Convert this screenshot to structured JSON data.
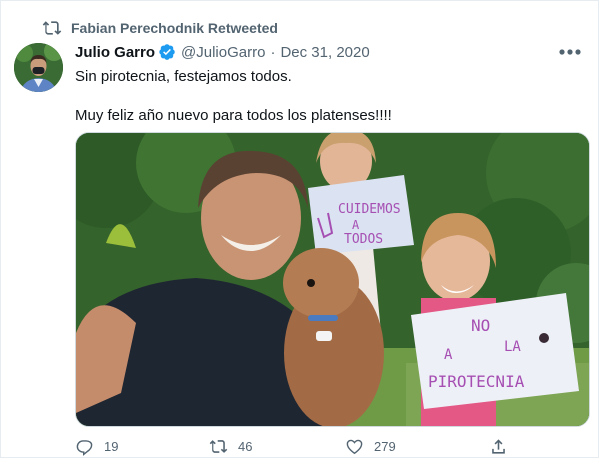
{
  "retweet": {
    "label": "Fabian Perechodnik Retweeted",
    "icon": "retweet-icon"
  },
  "tweet": {
    "author_name": "Julio Garro",
    "handle": "@JulioGarro",
    "separator": "·",
    "date": "Dec 31, 2020",
    "verified_icon": "verified-badge-icon",
    "text_line1": "Sin pirotecnia, festejamos todos.",
    "text_line2": "Muy feliz año nuevo para todos los platenses!!!!",
    "sign1": {
      "line1": "CUIDEMOS",
      "line2": "A",
      "line3": "TODOS"
    },
    "sign2": {
      "line1": "NO",
      "line2": "A",
      "line3": "LA",
      "line4": "PIROTECNIA"
    }
  },
  "actions": {
    "replies": "19",
    "retweets": "46",
    "likes": "279"
  },
  "colors": {
    "secondary_text": "#536471",
    "verified_blue": "#1d9bf0",
    "sign_text": "#a64fb3"
  }
}
